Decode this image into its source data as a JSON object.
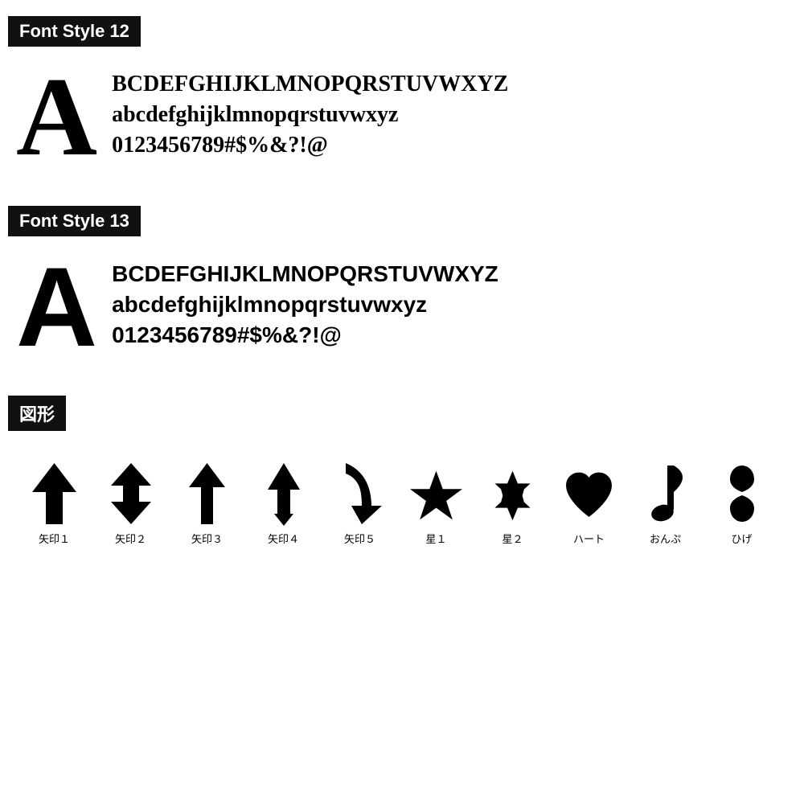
{
  "fontStyle12": {
    "label": "Font Style 12",
    "bigLetter": "A",
    "lines": [
      "BCDEFGHIJKLMNOPQRSTUVWXYZ",
      "abcdefghijklmnopqrstuvwxyz",
      "0123456789#$%&?!@"
    ]
  },
  "fontStyle13": {
    "label": "Font Style 13",
    "bigLetter": "A",
    "lines": [
      "BCDEFGHIJKLMNOPQRSTUVWXYZ",
      "abcdefghijklmnopqrstuvwxyz",
      "0123456789#$%&?!@"
    ]
  },
  "shapesSection": {
    "label": "図形",
    "symbols": [
      {
        "name": "矢印1",
        "type": "arrow1"
      },
      {
        "name": "矢印2",
        "type": "arrow2"
      },
      {
        "name": "矢印3",
        "type": "arrow3"
      },
      {
        "name": "矢印4",
        "type": "arrow4"
      },
      {
        "name": "矢印5",
        "type": "arrow5"
      },
      {
        "name": "星1",
        "type": "star1"
      },
      {
        "name": "星2",
        "type": "star2"
      },
      {
        "name": "ハート",
        "type": "heart"
      },
      {
        "name": "おんぷ",
        "type": "note"
      },
      {
        "name": "ひげ",
        "type": "moustache"
      }
    ]
  }
}
